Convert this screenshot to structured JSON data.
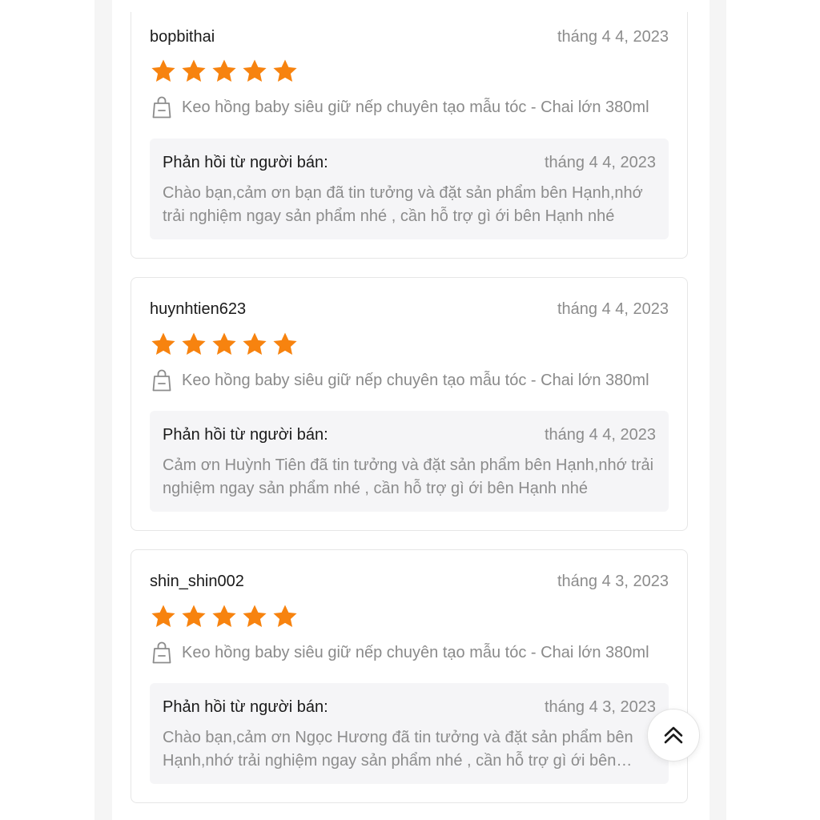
{
  "reviews": [
    {
      "username": "bopbithai",
      "date": "tháng 4 4, 2023",
      "rating": 5,
      "product": "Keo hồng baby siêu giữ nếp chuyên tạo mẫu tóc - Chai lớn 380ml",
      "reply": {
        "title": "Phản hồi từ người bán:",
        "date": "tháng 4 4, 2023",
        "text": "Chào bạn,cảm ơn bạn  đã tin tưởng và đặt sản phẩm bên Hạnh,nhớ trải nghiệm ngay sản phẩm nhé , cần hỗ trợ gì ới bên Hạnh nhé"
      }
    },
    {
      "username": "huynhtien623",
      "date": "tháng 4 4, 2023",
      "rating": 5,
      "product": "Keo hồng baby siêu giữ nếp chuyên tạo mẫu tóc - Chai lớn 380ml",
      "reply": {
        "title": "Phản hồi từ người bán:",
        "date": "tháng 4 4, 2023",
        "text": "Cảm ơn Huỳnh Tiên  đã tin tưởng và đặt sản phẩm bên Hạnh,nhớ trải nghiệm ngay sản phẩm nhé , cần hỗ trợ gì ới bên Hạnh nhé"
      }
    },
    {
      "username": "shin_shin002",
      "date": "tháng 4 3, 2023",
      "rating": 5,
      "product": "Keo hồng baby siêu giữ nếp chuyên tạo mẫu tóc - Chai lớn 380ml",
      "reply": {
        "title": "Phản hồi từ người bán:",
        "date": "tháng 4 3, 2023",
        "text": "Chào bạn,cảm ơn Ngọc Hương  đã tin tưởng và đặt sản phẩm bên Hạnh,nhớ trải nghiệm ngay sản phẩm nhé , cần hỗ trợ gì ới bên Hạnh nhé"
      }
    }
  ],
  "icons": {
    "star": "star-icon",
    "product": "shopping-bag-icon",
    "scroll_top": "double-chevron-up-icon"
  },
  "colors": {
    "star": "#f7830f",
    "text_primary": "#1a1a1a",
    "text_secondary": "#8c8c8c",
    "reply_bg": "#f5f5f7"
  }
}
